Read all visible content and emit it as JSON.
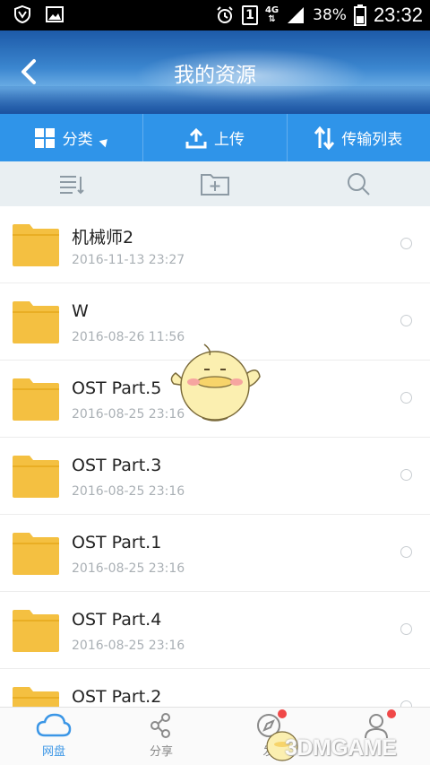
{
  "status_bar": {
    "carrier_badge": "1",
    "network": "4G",
    "battery": "38%",
    "time": "23:32"
  },
  "header": {
    "title": "我的资源"
  },
  "toolbar": {
    "classify_label": "分类",
    "upload_label": "上传",
    "transfer_label": "传输列表"
  },
  "files": [
    {
      "name": "机械师2",
      "date": "2016-11-13  23:27"
    },
    {
      "name": "W",
      "date": "2016-08-26  11:56"
    },
    {
      "name": "OST Part.5",
      "date": "2016-08-25  23:16"
    },
    {
      "name": "OST Part.3",
      "date": "2016-08-25  23:16"
    },
    {
      "name": "OST Part.1",
      "date": "2016-08-25  23:16"
    },
    {
      "name": "OST Part.4",
      "date": "2016-08-25  23:16"
    },
    {
      "name": "OST  Part.2",
      "date": ""
    }
  ],
  "bottom_nav": {
    "items": [
      {
        "label": "网盘",
        "active": true
      },
      {
        "label": "分享",
        "active": false
      },
      {
        "label": "发",
        "active": false
      },
      {
        "label": "",
        "active": false
      }
    ]
  },
  "watermark": "3DMGAME",
  "colors": {
    "toolbar": "#2f94e9",
    "subbar": "#e9eff2",
    "folder": "#f4c041",
    "active_nav": "#3b96e6"
  }
}
